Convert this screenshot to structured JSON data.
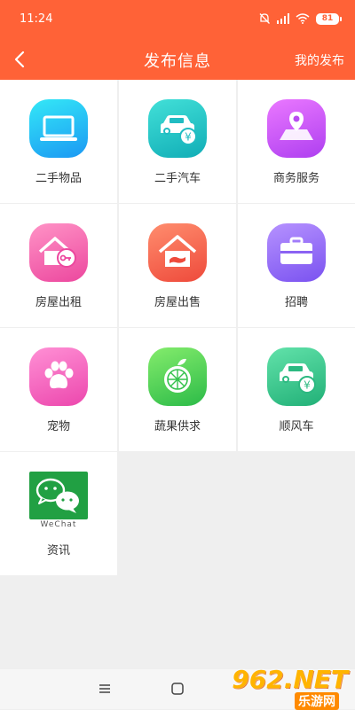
{
  "status": {
    "time": "11:24",
    "battery": "81"
  },
  "header": {
    "title": "发布信息",
    "right_action": "我的发布"
  },
  "categories": [
    {
      "label": "二手物品",
      "icon": "laptop-icon",
      "color_from": "#2ee6f6",
      "color_to": "#1a9ef4"
    },
    {
      "label": "二手汽车",
      "icon": "car-yen-icon",
      "color_from": "#3cdcd6",
      "color_to": "#12b3b9"
    },
    {
      "label": "商务服务",
      "icon": "map-pin-icon",
      "color_from": "#e471ff",
      "color_to": "#b144f0"
    },
    {
      "label": "房屋出租",
      "icon": "house-key-icon",
      "color_from": "#ff8dc2",
      "color_to": "#ef4aa0"
    },
    {
      "label": "房屋出售",
      "icon": "house-hand-icon",
      "color_from": "#ff8a6c",
      "color_to": "#f04c3e"
    },
    {
      "label": "招聘",
      "icon": "briefcase-icon",
      "color_from": "#b08cff",
      "color_to": "#7c55f2"
    },
    {
      "label": "宠物",
      "icon": "paw-icon",
      "color_from": "#ff8ad2",
      "color_to": "#ee4cb0"
    },
    {
      "label": "蔬果供求",
      "icon": "fruit-icon",
      "color_from": "#7ee86a",
      "color_to": "#2fbe4a"
    },
    {
      "label": "顺风车",
      "icon": "car-yen-icon",
      "color_from": "#5ee0a8",
      "color_to": "#23b37a"
    },
    {
      "label": "资讯",
      "icon": "wechat-logo",
      "logo_text": "WeChat"
    }
  ],
  "watermark": {
    "big": "962.NET",
    "small": "乐游网"
  }
}
